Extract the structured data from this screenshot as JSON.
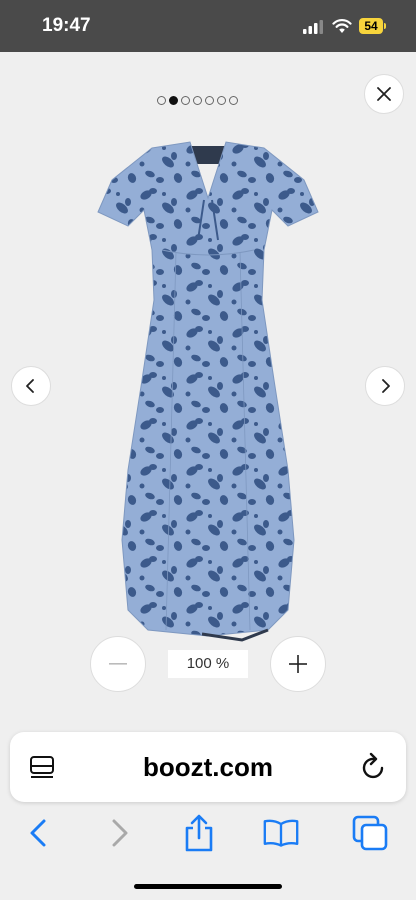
{
  "status_bar": {
    "time": "19:47",
    "battery": "54"
  },
  "viewer": {
    "image_count": 7,
    "active_image_index": 1,
    "zoom_level": "100 %"
  },
  "browser": {
    "url": "boozt.com"
  },
  "colors": {
    "dress_base": "#91acd4",
    "dress_print": "#3a5887",
    "accent": "#1a7cf5"
  }
}
